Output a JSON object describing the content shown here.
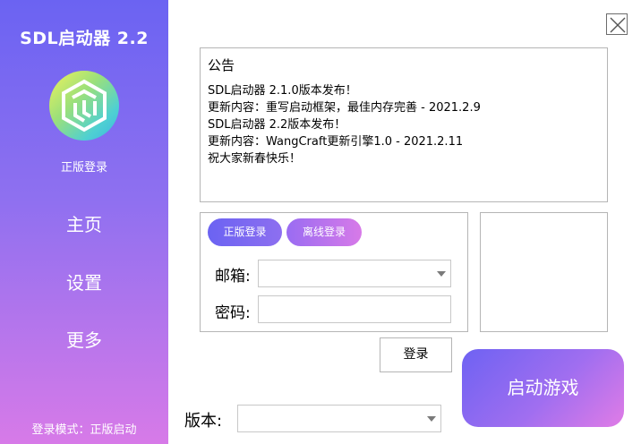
{
  "sidebar": {
    "title": "SDL启动器 2.2",
    "login_status": "正版登录",
    "nav": {
      "home": "主页",
      "settings": "设置",
      "more": "更多"
    },
    "login_mode": "登录模式：正版启动",
    "colors": {
      "top": "#6b63f2",
      "bottom": "#d77ae8"
    }
  },
  "announcement": {
    "title": "公告",
    "lines": [
      "SDL启动器 2.1.0版本发布！",
      "更新内容：重写启动框架，最佳内存完善 - 2021.2.9",
      "SDL启动器 2.2版本发布！",
      "更新内容：WangCraft更新引擎1.0 - 2021.2.11",
      "祝大家新春快乐！"
    ]
  },
  "login": {
    "online_tab": "正版登录",
    "offline_tab": "离线登录",
    "email_label": "邮箱:",
    "email_value": "",
    "password_label": "密码:",
    "password_value": "",
    "login_button": "登录"
  },
  "launch_button": "启动游戏",
  "version": {
    "label": "版本:",
    "selected": ""
  },
  "icons": {
    "close": "close-icon",
    "logo": "sdl-logo-icon",
    "dropdown": "chevron-down-icon"
  }
}
